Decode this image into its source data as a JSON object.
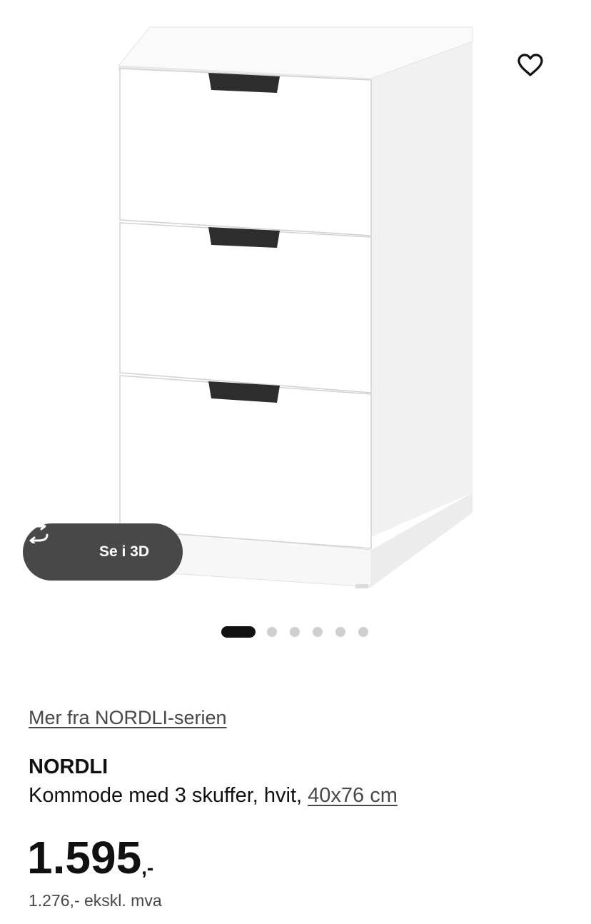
{
  "product": {
    "series_link": "Mer fra NORDLI-serien",
    "name": "NORDLI",
    "description": "Kommode med 3 skuffer, hvit,",
    "measurement": "40x76 cm",
    "price": {
      "amount": "1.595",
      "suffix": ",-",
      "excl_vat": "1.276,- ekskl. mva"
    }
  },
  "gallery": {
    "see_3d_label": "Se i 3D",
    "see_3d_icon": "rotate-3d-icon",
    "favourite_icon": "heart-outline-icon",
    "slide_count": 6,
    "active_slide": 1
  },
  "colors": {
    "text": "#111111",
    "secondary_text": "#484848",
    "pill_background": "#484848",
    "dot_inactive": "#cfcfcf",
    "dot_active": "#111111"
  }
}
